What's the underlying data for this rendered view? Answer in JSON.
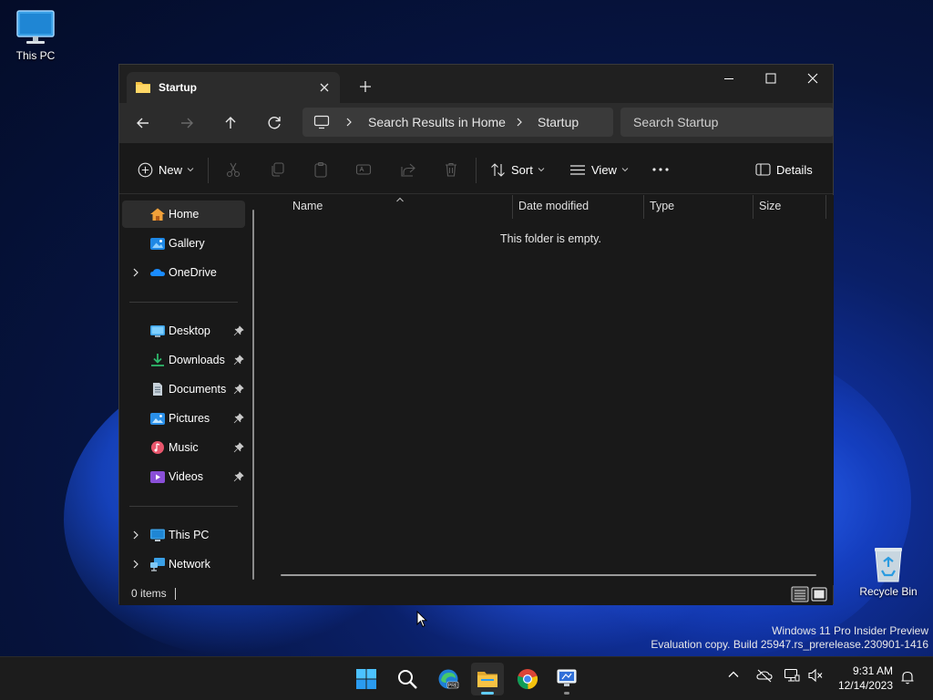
{
  "desktop": {
    "this_pc_label": "This PC",
    "recycle_bin_label": "Recycle Bin",
    "watermark_line1": "Windows 11 Pro Insider Preview",
    "watermark_line2": "Evaluation copy. Build 25947.rs_prerelease.230901-1416"
  },
  "window": {
    "tab_title": "Startup",
    "new_tab_icon": "plus-icon",
    "controls": [
      "minimize-icon",
      "maximize-icon",
      "close-icon"
    ]
  },
  "address_bar": {
    "root_icon": "monitor-icon",
    "breadcrumbs": [
      "Search Results in Home",
      "Startup"
    ]
  },
  "search": {
    "placeholder": "Search Startup"
  },
  "command_bar": {
    "new_label": "New",
    "sort_label": "Sort",
    "view_label": "View",
    "details_label": "Details",
    "disabled_actions": [
      "cut-icon",
      "copy-icon",
      "paste-icon",
      "rename-icon",
      "share-icon",
      "delete-icon"
    ]
  },
  "sidebar": {
    "items": [
      {
        "label": "Home",
        "icon": "home-icon",
        "selected": true
      },
      {
        "label": "Gallery",
        "icon": "gallery-icon"
      },
      {
        "label": "OneDrive",
        "icon": "cloud-icon",
        "expandable": true
      },
      {
        "label": "Desktop",
        "icon": "desktop-folder-icon",
        "pinned": true
      },
      {
        "label": "Downloads",
        "icon": "download-icon",
        "pinned": true
      },
      {
        "label": "Documents",
        "icon": "document-icon",
        "pinned": true
      },
      {
        "label": "Pictures",
        "icon": "pictures-icon",
        "pinned": true
      },
      {
        "label": "Music",
        "icon": "music-icon",
        "pinned": true
      },
      {
        "label": "Videos",
        "icon": "videos-icon",
        "pinned": true
      },
      {
        "label": "This PC",
        "icon": "computer-icon",
        "expandable": true
      },
      {
        "label": "Network",
        "icon": "network-icon",
        "expandable": true
      }
    ]
  },
  "content": {
    "columns": [
      "Name",
      "Date modified",
      "Type",
      "Size"
    ],
    "empty_message": "This folder is empty."
  },
  "status": {
    "item_count": "0 items"
  },
  "taskbar": {
    "apps": [
      "start-icon",
      "search-icon",
      "edge-beta-icon",
      "file-explorer-icon",
      "chrome-icon",
      "remote-desktop-icon"
    ],
    "time": "9:31 AM",
    "date": "12/14/2023"
  },
  "colors": {
    "accent": "#60cdff",
    "window_bg": "#191919",
    "navbar_bg": "#2c2c2c",
    "folder_yellow": "#f6c244"
  }
}
